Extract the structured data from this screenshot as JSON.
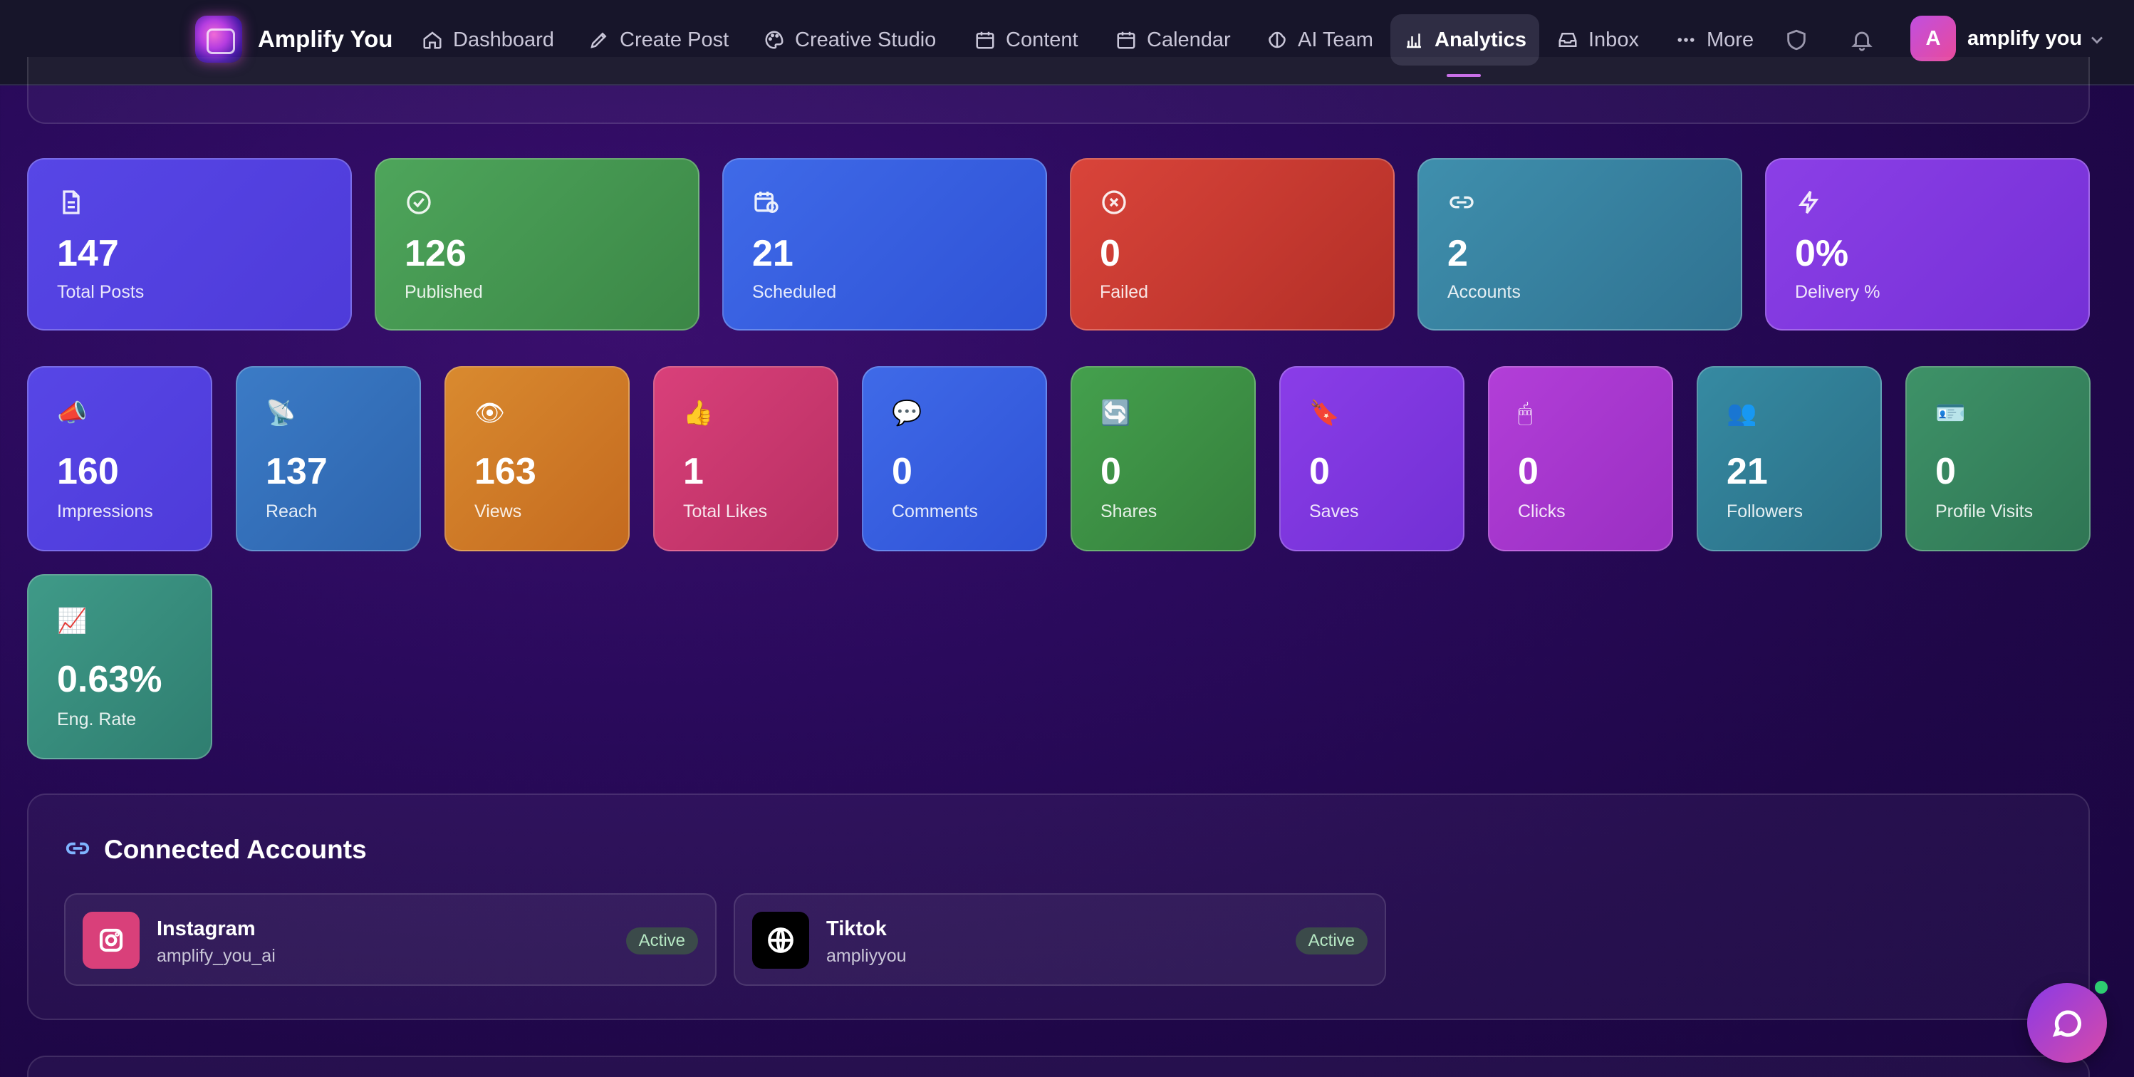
{
  "app": {
    "name": "Amplify You"
  },
  "nav": {
    "items": [
      {
        "label": "Dashboard",
        "icon": "home-icon"
      },
      {
        "label": "Create Post",
        "icon": "pen-icon"
      },
      {
        "label": "Creative Studio",
        "icon": "palette-icon"
      },
      {
        "label": "Content",
        "icon": "calendar-icon"
      },
      {
        "label": "Calendar",
        "icon": "calendar-icon"
      },
      {
        "label": "AI Team",
        "icon": "brain-icon"
      },
      {
        "label": "Analytics",
        "icon": "bar-chart-icon",
        "active": true
      },
      {
        "label": "Inbox",
        "icon": "inbox-icon"
      },
      {
        "label": "More",
        "icon": "more-dots-icon"
      }
    ]
  },
  "user": {
    "initial": "A",
    "name": "amplify you"
  },
  "summary_cards": [
    {
      "value": "147",
      "label": "Total Posts",
      "icon": "document-icon"
    },
    {
      "value": "126",
      "label": "Published",
      "icon": "check-circle-icon"
    },
    {
      "value": "21",
      "label": "Scheduled",
      "icon": "calendar-clock-icon"
    },
    {
      "value": "0",
      "label": "Failed",
      "icon": "x-circle-icon"
    },
    {
      "value": "2",
      "label": "Accounts",
      "icon": "link-icon"
    },
    {
      "value": "0%",
      "label": "Delivery %",
      "icon": "lightning-icon"
    }
  ],
  "metric_cards": [
    {
      "value": "160",
      "label": "Impressions",
      "emoji": "📣"
    },
    {
      "value": "137",
      "label": "Reach",
      "emoji": "📡"
    },
    {
      "value": "163",
      "label": "Views",
      "emoji": "👁"
    },
    {
      "value": "1",
      "label": "Total Likes",
      "emoji": "👍"
    },
    {
      "value": "0",
      "label": "Comments",
      "emoji": "💬"
    },
    {
      "value": "0",
      "label": "Shares",
      "emoji": "🔄"
    },
    {
      "value": "0",
      "label": "Saves",
      "emoji": "🔖"
    },
    {
      "value": "0",
      "label": "Clicks",
      "emoji": "🖱"
    },
    {
      "value": "21",
      "label": "Followers",
      "emoji": "👥"
    },
    {
      "value": "0",
      "label": "Profile Visits",
      "emoji": "🪪"
    },
    {
      "value": "0.63%",
      "label": "Eng. Rate",
      "emoji": "📈"
    }
  ],
  "connected_accounts": {
    "title": "Connected Accounts",
    "items": [
      {
        "platform": "Instagram",
        "handle": "amplify_you_ai",
        "status": "Active",
        "color": "#d9407a"
      },
      {
        "platform": "Tiktok",
        "handle": "ampliyyou",
        "status": "Active",
        "color": "#000000"
      }
    ]
  }
}
